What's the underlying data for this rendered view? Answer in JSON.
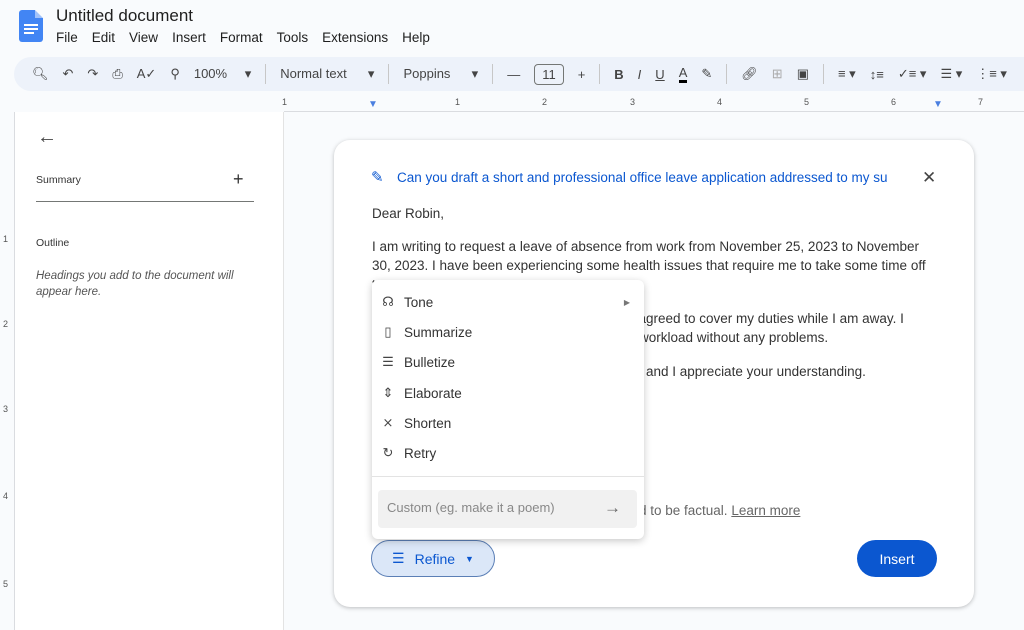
{
  "app": {
    "title": "Untitled document",
    "menu": [
      "File",
      "Edit",
      "View",
      "Insert",
      "Format",
      "Tools",
      "Extensions",
      "Help"
    ]
  },
  "toolbar": {
    "zoom": "100%",
    "style": "Normal text",
    "font": "Poppins",
    "font_size": "11",
    "text_color": "#000000"
  },
  "ruler": {
    "h": [
      "1",
      "1",
      "2",
      "3",
      "4",
      "5",
      "6",
      "7"
    ],
    "v": [
      "1",
      "2",
      "3",
      "4",
      "5"
    ]
  },
  "sidebar": {
    "summary": "Summary",
    "outline": "Outline",
    "outline_hint": "Headings you add to the document will appear here."
  },
  "card": {
    "prompt": "Can you draft a short and professional office leave application addressed to my su",
    "greeting": "Dear Robin,",
    "p1": "I am writing to request a leave of absence from work from November 25, 2023 to November 30, 2023. I have been experiencing some health issues that require me to take some time off to",
    "p2a": "is agreed to cover my duties while I am away. I",
    "p2b": "workload without any problems.",
    "p3": "se and I appreciate your understanding.",
    "disclaimer": "d to be factual.",
    "learn_more": "Learn more",
    "refine": "Refine",
    "insert": "Insert"
  },
  "refine_menu": {
    "items": [
      {
        "label": "Tone",
        "icon": "tone-icon"
      },
      {
        "label": "Summarize",
        "icon": "summarize-icon"
      },
      {
        "label": "Bulletize",
        "icon": "bulletize-icon"
      },
      {
        "label": "Elaborate",
        "icon": "elaborate-icon"
      },
      {
        "label": "Shorten",
        "icon": "shorten-icon"
      },
      {
        "label": "Retry",
        "icon": "retry-icon"
      }
    ],
    "custom_placeholder": "Custom (eg. make it a poem)"
  },
  "colors": {
    "accent": "#0b57d0",
    "toolbar_bg": "#edf2fa"
  }
}
